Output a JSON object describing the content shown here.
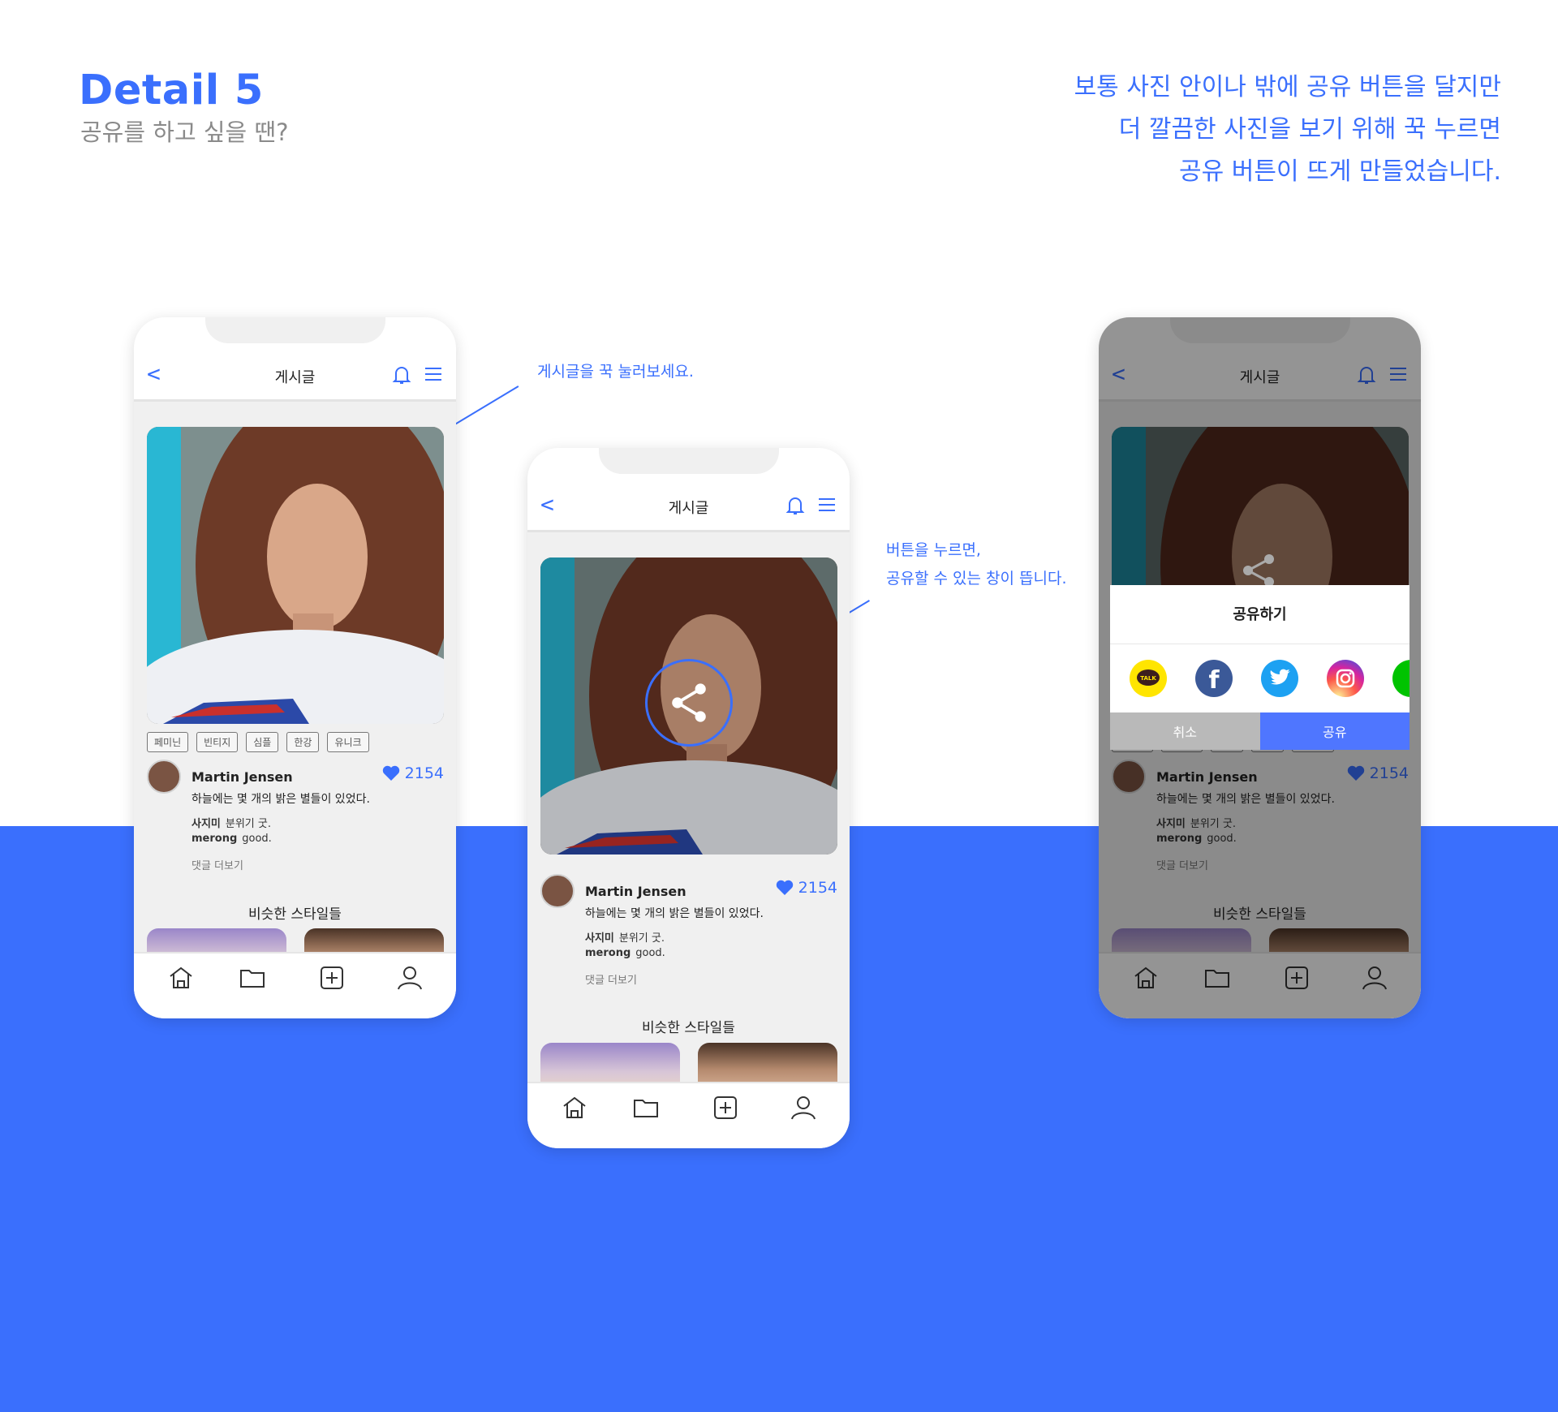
{
  "slide": {
    "title": "Detail 5",
    "subtitle": "공유를 하고 싶을 땐?",
    "description": [
      "보통 사진 안이나 밖에 공유 버튼을 달지만",
      "더 깔끔한 사진을 보기 위해 꾹 누르면",
      "공유 버튼이 뜨게 만들었습니다."
    ]
  },
  "annotations": {
    "long_press": "게시글을 꾹 눌러보세요.",
    "share_button": [
      "버튼을 누르면,",
      "공유할 수 있는 창이 뜹니다."
    ]
  },
  "colors": {
    "accent": "#3a6ffd",
    "background_band": "#3a6ffd",
    "share_confirm": "#4f76ff",
    "share_cancel": "#b9b9b9",
    "overlay": "rgba(0,0,0,0.42)"
  },
  "phone": {
    "header": {
      "back_icon": "chevron-left-icon",
      "title": "게시글",
      "bell_icon": "bell-icon",
      "menu_icon": "hamburger-menu-icon"
    },
    "tags": [
      "페미닌",
      "빈티지",
      "심플",
      "한강",
      "유니크"
    ],
    "post": {
      "author": "Martin Jensen",
      "likes": "2154",
      "caption": "하늘에는 몇 개의 밝은 별들이 있었다.",
      "comments": [
        {
          "user": "사지미",
          "text": "분위기 굿."
        },
        {
          "user": "merong",
          "text": "good."
        }
      ],
      "more_comments": "댓글 더보기"
    },
    "similar_title": "비슷한 스타일들",
    "tabbar": [
      "home-icon",
      "folder-icon",
      "add-square-icon",
      "profile-icon"
    ]
  },
  "share_sheet": {
    "title": "공유하기",
    "apps": [
      {
        "name": "kakaotalk-icon",
        "label": "TALK",
        "color": "#ffe500"
      },
      {
        "name": "facebook-icon",
        "label": "f",
        "color": "#3b5998"
      },
      {
        "name": "twitter-icon",
        "label": "",
        "color": "#1da1f2"
      },
      {
        "name": "instagram-icon",
        "label": "",
        "color": "#d6249f"
      },
      {
        "name": "line-icon",
        "label": "",
        "color": "#00c300"
      }
    ],
    "cancel": "취소",
    "confirm": "공유"
  }
}
